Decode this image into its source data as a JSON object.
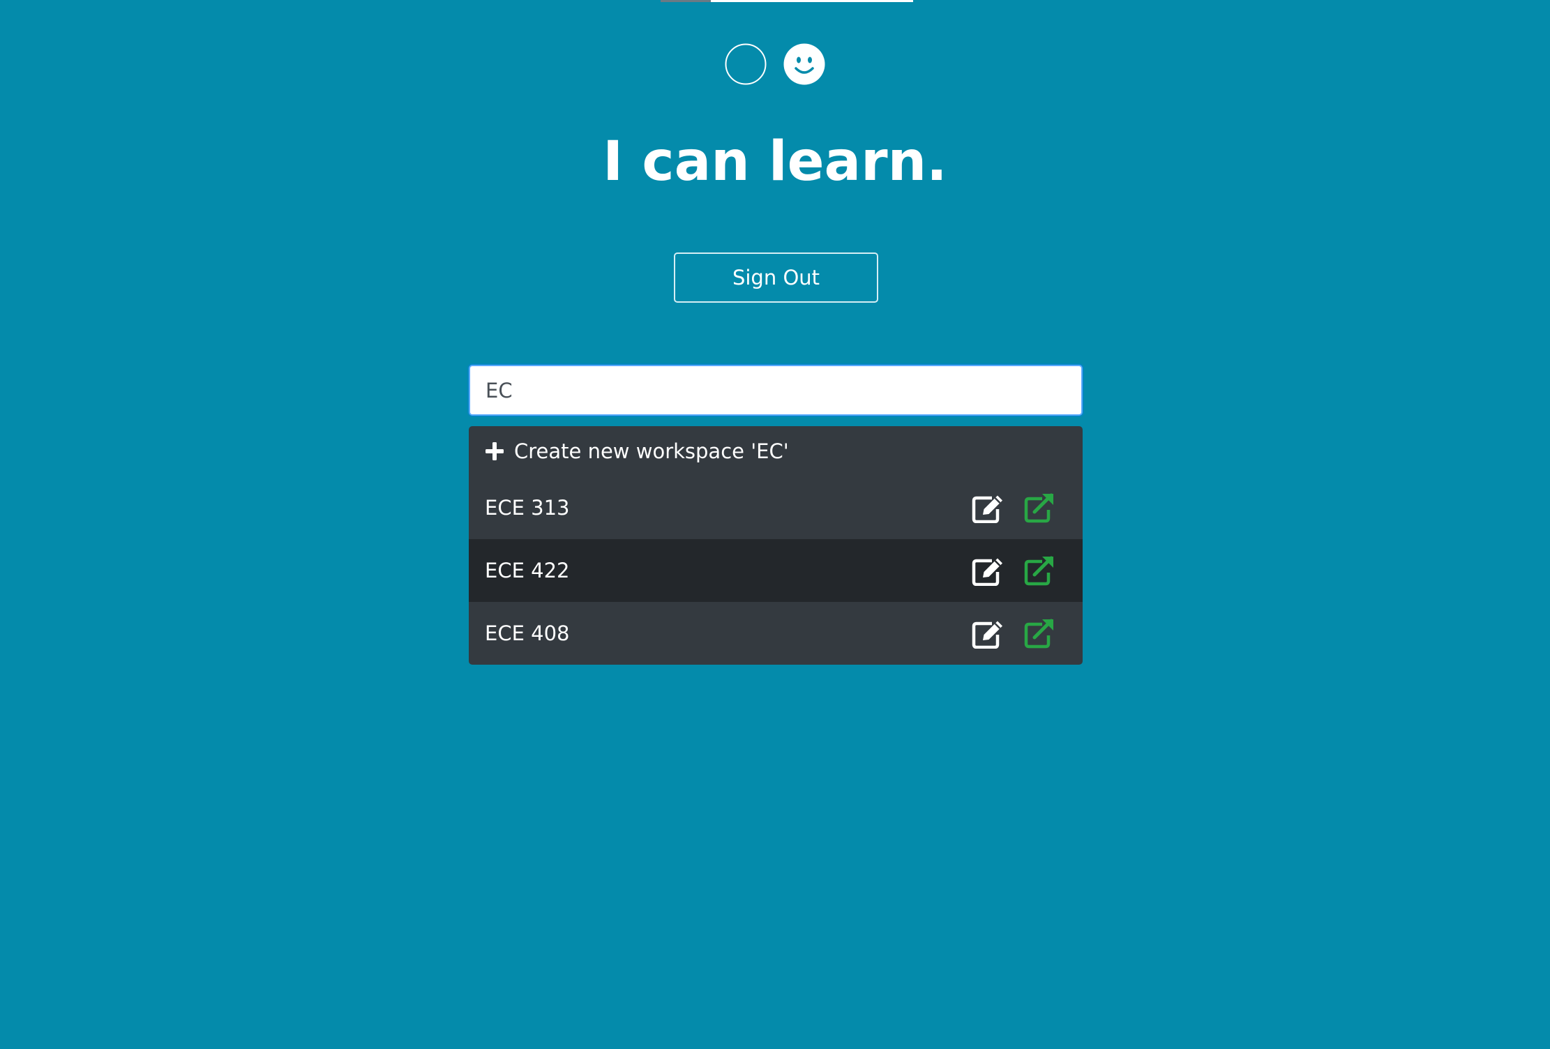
{
  "colors": {
    "background": "#048bab",
    "dropdown": "#343a40",
    "dropdown_active": "#23272b",
    "open_icon": "#28a745",
    "text": "#ffffff"
  },
  "mood": {
    "options": [
      {
        "icon": "empty-circle-icon",
        "selected": false
      },
      {
        "icon": "smiley-face-icon",
        "selected": true
      }
    ]
  },
  "page": {
    "title": "I can learn."
  },
  "header": {
    "sign_out_label": "Sign Out"
  },
  "search": {
    "value": "EC",
    "placeholder": ""
  },
  "results": {
    "create_label": "Create new workspace 'EC'",
    "create_icon": "plus-icon",
    "workspaces": [
      {
        "name": "ECE 313",
        "active": false,
        "edit_icon": "edit-icon",
        "open_icon": "external-link-icon"
      },
      {
        "name": "ECE 422",
        "active": true,
        "edit_icon": "edit-icon",
        "open_icon": "external-link-icon"
      },
      {
        "name": "ECE 408",
        "active": false,
        "edit_icon": "edit-icon",
        "open_icon": "external-link-icon"
      }
    ]
  }
}
